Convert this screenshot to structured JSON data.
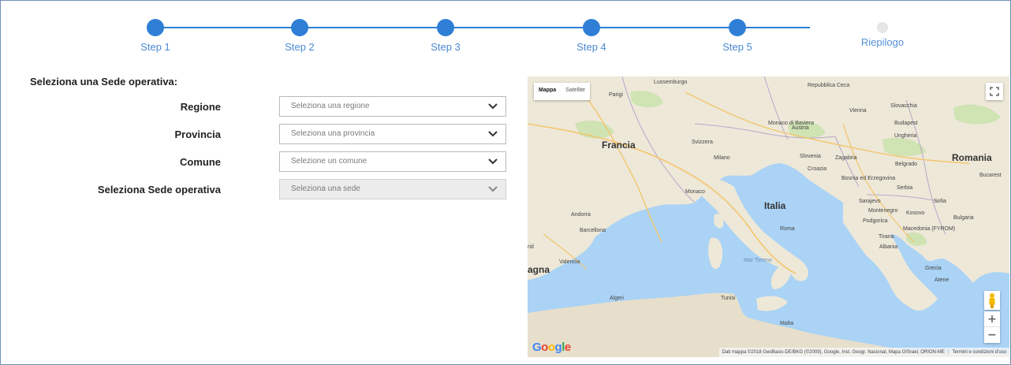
{
  "stepper": {
    "steps": [
      {
        "label": "Step 1"
      },
      {
        "label": "Step 2"
      },
      {
        "label": "Step 3"
      },
      {
        "label": "Step 4"
      },
      {
        "label": "Step 5"
      },
      {
        "label": "Riepilogo"
      }
    ]
  },
  "form": {
    "title": "Seleziona una Sede operativa:",
    "fields": [
      {
        "label": "Regione",
        "placeholder": "Seleziona una regione"
      },
      {
        "label": "Provincia",
        "placeholder": "Seleziona una provincia"
      },
      {
        "label": "Comune",
        "placeholder": "Selezione un comune"
      },
      {
        "label": "Seleziona Sede operativa",
        "placeholder": "Seleziona una sede"
      }
    ]
  },
  "map": {
    "type_buttons": {
      "map": "Mappa",
      "satellite": "Satellite"
    },
    "zoom": {
      "in": "+",
      "out": "−"
    },
    "logo": "Google",
    "attribution": "Dati mappa ©2018 GeoBasis-DE/BKG (©2009), Google, Inst. Geogr. Nacional, Mapa GISrael, ORION-ME",
    "terms": "Termini e condizioni d'uso",
    "labels": {
      "francia": "Francia",
      "italia": "Italia",
      "romania": "Romania",
      "parigi": "Parigi",
      "lussemburgo": "Lussemburgo",
      "monaco_baviera": "Monaco di Baviera",
      "svizzera": "Svizzera",
      "repubblica_ceca": "Repubblica Ceca",
      "vienna": "Vienna",
      "slovacchia": "Slovacchia",
      "austria": "Austria",
      "budapest": "Budapest",
      "ungheria": "Ungheria",
      "slovenia": "Slovenia",
      "zagabria": "Zagabria",
      "croazia": "Croazia",
      "milano": "Milano",
      "monaco": "Monaco",
      "bosnia": "Bosnia ed Erzegovina",
      "belgrado": "Belgrado",
      "serbia": "Serbia",
      "bucarest": "Bucarest",
      "sofia": "Sofia",
      "bulgaria": "Bulgaria",
      "sarajevo": "Sarajevo",
      "montenegro": "Montenegro",
      "kosovo": "Kosovo",
      "podgorica": "Podgorica",
      "tirana": "Tirana",
      "albania": "Albania",
      "macedonia": "Macedonia (FYROM)",
      "andorra": "Andorra",
      "barcellona": "Barcellona",
      "roma": "Roma",
      "mar_tirreno": "Mar Tirreno",
      "valencia": "Valencia",
      "agna": "agna",
      "algeri": "Algeri",
      "tunisi": "Tunisi",
      "malta": "Malta",
      "grecia": "Grecia",
      "atene": "Atene",
      "rid": "rid"
    }
  }
}
